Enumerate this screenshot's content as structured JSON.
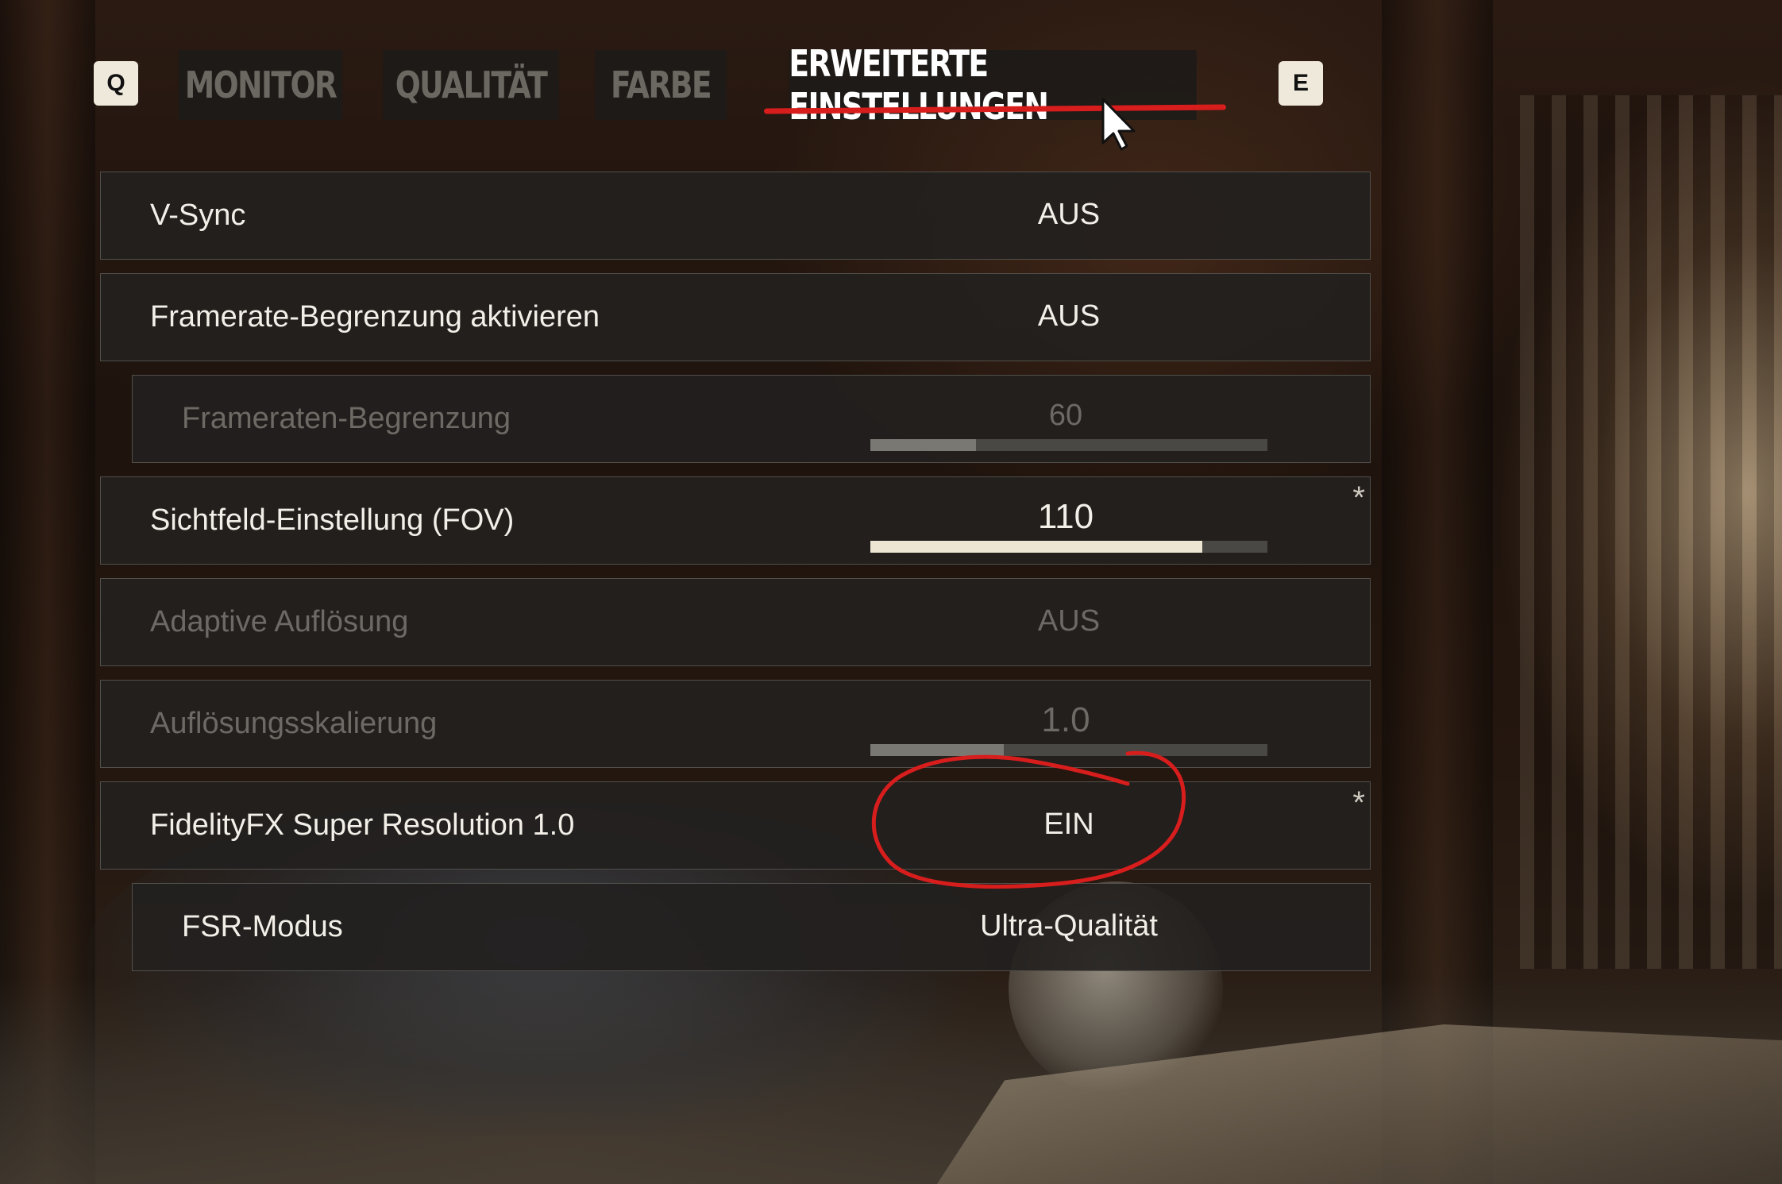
{
  "tabs": {
    "prev_key": "Q",
    "next_key": "E",
    "items": [
      {
        "label": "MONITOR",
        "active": false
      },
      {
        "label": "QUALITÄT",
        "active": false
      },
      {
        "label": "FARBE",
        "active": false
      },
      {
        "label": "ERWEITERTE EINSTELLUNGEN",
        "active": true
      }
    ]
  },
  "settings": [
    {
      "label": "V-Sync",
      "value": "AUS",
      "enabled": true
    },
    {
      "label": "Framerate-Begrenzung aktivieren",
      "value": "AUS",
      "enabled": true
    },
    {
      "label": "Frameraten-Begrenzung",
      "value": "60",
      "enabled": false,
      "slider_level": 0.265
    },
    {
      "label": "Sichtfeld-Einstellung (FOV)",
      "value": "110",
      "enabled": true,
      "slider_level": 0.835,
      "modified_marker": "*"
    },
    {
      "label": "Adaptive Auflösung",
      "value": "AUS",
      "enabled": false
    },
    {
      "label": "Auflösungsskalierung",
      "value": "1.0",
      "enabled": false,
      "slider_level": 0.335
    },
    {
      "label": "FidelityFX Super Resolution 1.0",
      "value": "EIN",
      "enabled": true,
      "modified_marker": "*"
    },
    {
      "label": "FSR-Modus",
      "value": "Ultra-Qualität",
      "enabled": true
    }
  ],
  "colors": {
    "accent_red": "#d81d1d",
    "slider_fill_active": "#ede6d3",
    "slider_fill_disabled": "#7a7873",
    "text_primary": "#f2efe8",
    "text_disabled": "#6d6a65"
  }
}
